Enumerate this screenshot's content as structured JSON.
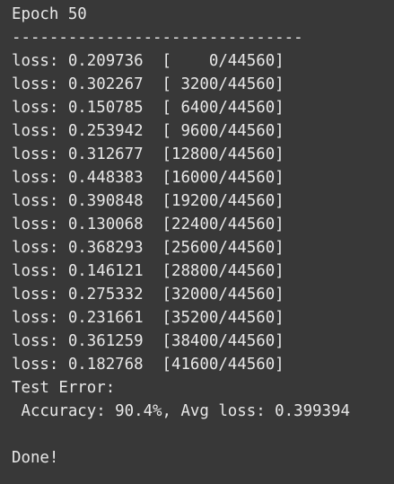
{
  "output": {
    "epoch_header": "Epoch 50",
    "separator": "-------------------------------",
    "loss_lines": [
      "loss: 0.209736  [    0/44560]",
      "loss: 0.302267  [ 3200/44560]",
      "loss: 0.150785  [ 6400/44560]",
      "loss: 0.253942  [ 9600/44560]",
      "loss: 0.312677  [12800/44560]",
      "loss: 0.448383  [16000/44560]",
      "loss: 0.390848  [19200/44560]",
      "loss: 0.130068  [22400/44560]",
      "loss: 0.368293  [25600/44560]",
      "loss: 0.146121  [28800/44560]",
      "loss: 0.275332  [32000/44560]",
      "loss: 0.231661  [35200/44560]",
      "loss: 0.361259  [38400/44560]",
      "loss: 0.182768  [41600/44560]"
    ],
    "test_error_label": "Test Error:",
    "accuracy_line": " Accuracy: 90.4%, Avg loss: 0.399394",
    "blank_line": "",
    "done_line": "Done!"
  }
}
